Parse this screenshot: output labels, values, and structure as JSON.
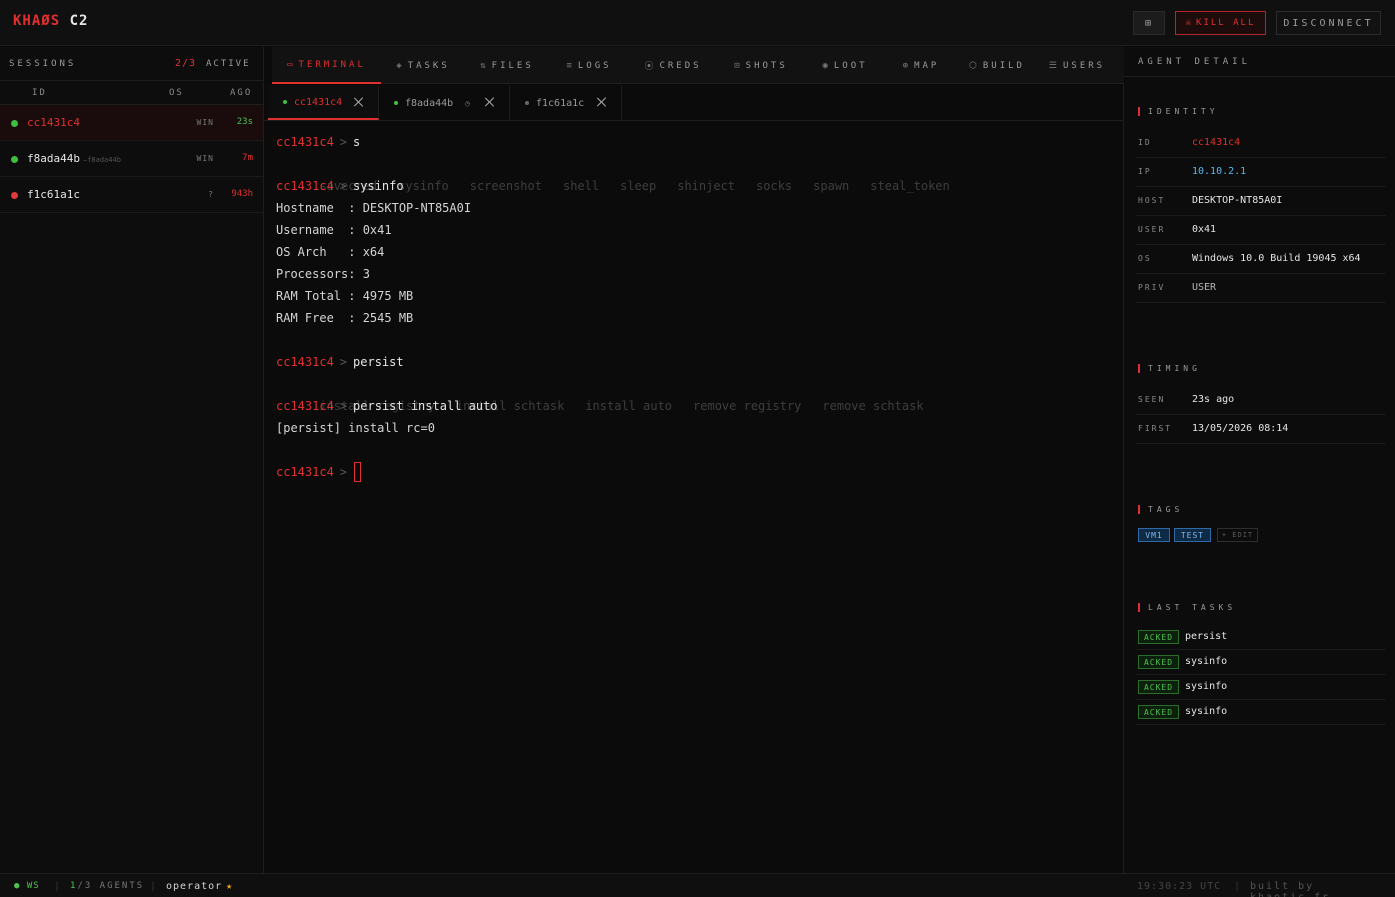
{
  "brand": {
    "part1": "KHAØS",
    "part2": "C2"
  },
  "topbar": {
    "layout_icon": "⊞",
    "kill_icon": "☠",
    "kill_label": "KILL ALL",
    "disconnect_label": "DISCONNECT"
  },
  "sessions": {
    "title": "SESSIONS",
    "count": "2/3",
    "active_label": "ACTIVE",
    "columns": {
      "id": "ID",
      "os": "OS",
      "ago": "AGO"
    },
    "rows": [
      {
        "id": "cc1431c4",
        "alias": "",
        "os": "WIN",
        "ago": "23s",
        "status_color": "#3fbf3f",
        "ago_color": "#4ec24e"
      },
      {
        "id": "f8ada44b",
        "alias": "—f8ada44b",
        "os": "WIN",
        "ago": "7m",
        "status_color": "#3fbf3f",
        "ago_color": "#e0302f"
      },
      {
        "id": "f1c61a1c",
        "alias": "",
        "os": "?",
        "ago": "943h",
        "status_color": "#e03a3a",
        "ago_color": "#e0302f"
      }
    ]
  },
  "nav": {
    "tabs": [
      {
        "icon": "▭",
        "label": "TERMINAL"
      },
      {
        "icon": "◈",
        "label": "TASKS"
      },
      {
        "icon": "⇅",
        "label": "FILES"
      },
      {
        "icon": "≡",
        "label": "LOGS"
      },
      {
        "icon": "⦿",
        "label": "CREDS"
      },
      {
        "icon": "⊡",
        "label": "SHOTS"
      },
      {
        "icon": "◉",
        "label": "LOOT"
      },
      {
        "icon": "⊕",
        "label": "MAP"
      },
      {
        "icon": "⬡",
        "label": "BUILD"
      },
      {
        "icon": "☰",
        "label": "USERS"
      }
    ]
  },
  "session_tabs": [
    {
      "label": "cc1431c4",
      "dot_color": "#3fbf3f"
    },
    {
      "label": "f8ada44b",
      "dot_color": "#3fbf3f",
      "clock_icon": "◷"
    },
    {
      "label": "f1c61a1c",
      "dot_color": "#666666"
    }
  ],
  "terminal": {
    "prompt": "cc1431c4",
    "gt": ">",
    "cmd1": "s",
    "suggestions1": [
      "savecred",
      "sysinfo",
      "screenshot",
      "shell",
      "sleep",
      "shinject",
      "socks",
      "spawn",
      "steal_token"
    ],
    "cmd2": "sysinfo",
    "output_sysinfo": [
      "Hostname  : DESKTOP-NT85A0I",
      "Username  : 0x41",
      "OS Arch   : x64",
      "Processors: 3",
      "RAM Total : 4975 MB",
      "RAM Free  : 2545 MB"
    ],
    "cmd3": "persist",
    "suggestions2": [
      "install registry",
      "install schtask",
      "install auto",
      "remove registry",
      "remove schtask"
    ],
    "cmd4": "persist install auto",
    "output_persist": "[persist] install rc=0"
  },
  "detail": {
    "title": "AGENT DETAIL",
    "identity_label": "IDENTITY",
    "identity": [
      {
        "key": "ID",
        "value": "cc1431c4"
      },
      {
        "key": "IP",
        "value": "10.10.2.1"
      },
      {
        "key": "HOST",
        "value": "DESKTOP-NT85A0I"
      },
      {
        "key": "USER",
        "value": "0x41"
      },
      {
        "key": "OS",
        "value": "Windows 10.0 Build 19045 x64"
      },
      {
        "key": "PRIV",
        "value": "USER"
      }
    ],
    "timing_label": "TIMING",
    "timing": [
      {
        "key": "SEEN",
        "value": "23s ago"
      },
      {
        "key": "FIRST",
        "value": "13/05/2026 08:14"
      }
    ],
    "tags_label": "TAGS",
    "tags": [
      "VM1",
      "TEST"
    ],
    "edit_label": "+ EDIT",
    "tasks_label": "LAST TASKS",
    "tasks": [
      {
        "status": "ACKED",
        "name": "persist"
      },
      {
        "status": "ACKED",
        "name": "sysinfo"
      },
      {
        "status": "ACKED",
        "name": "sysinfo"
      },
      {
        "status": "ACKED",
        "name": "sysinfo"
      }
    ]
  },
  "status": {
    "ws": "● WS",
    "agents_online": "1",
    "agents_total": "/3 AGENTS",
    "operator": "operator",
    "star": "★",
    "time": "19:30:23 UTC",
    "built": "built by khaotic.fr"
  }
}
